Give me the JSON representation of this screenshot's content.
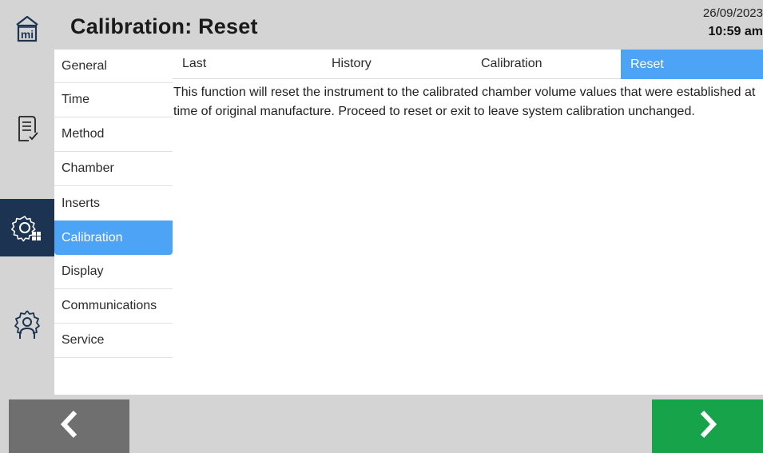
{
  "header": {
    "title": "Calibration: Reset",
    "date": "26/09/2023",
    "time": "10:59 am"
  },
  "rail": {
    "items": [
      {
        "icon": "home-mi-icon",
        "active": false
      },
      {
        "icon": "checklist-icon",
        "active": false
      },
      {
        "icon": "settings-grid-icon",
        "active": true
      },
      {
        "icon": "user-settings-icon",
        "active": false
      }
    ]
  },
  "submenu": {
    "items": [
      {
        "label": "General"
      },
      {
        "label": "Time"
      },
      {
        "label": "Method"
      },
      {
        "label": "Chamber"
      },
      {
        "label": "Inserts"
      },
      {
        "label": "Calibration",
        "active": true
      },
      {
        "label": "Display"
      },
      {
        "label": "Communications"
      },
      {
        "label": "Service"
      }
    ]
  },
  "tabs": [
    {
      "label": "Last"
    },
    {
      "label": "History"
    },
    {
      "label": "Calibration"
    },
    {
      "label": "Reset",
      "active": true
    }
  ],
  "content": {
    "text": "This function will reset the instrument to the calibrated chamber volume values that were established at time of original manufacture. Proceed to reset or exit to leave system calibration unchanged."
  },
  "footer": {
    "back_icon": "chevron-left-icon",
    "next_icon": "chevron-right-icon"
  },
  "colors": {
    "accent": "#4da3f5",
    "rail_active": "#1c3352",
    "chrome": "#d4d4d4",
    "back_button": "#6f6f6f",
    "next_button": "#17a34a"
  }
}
